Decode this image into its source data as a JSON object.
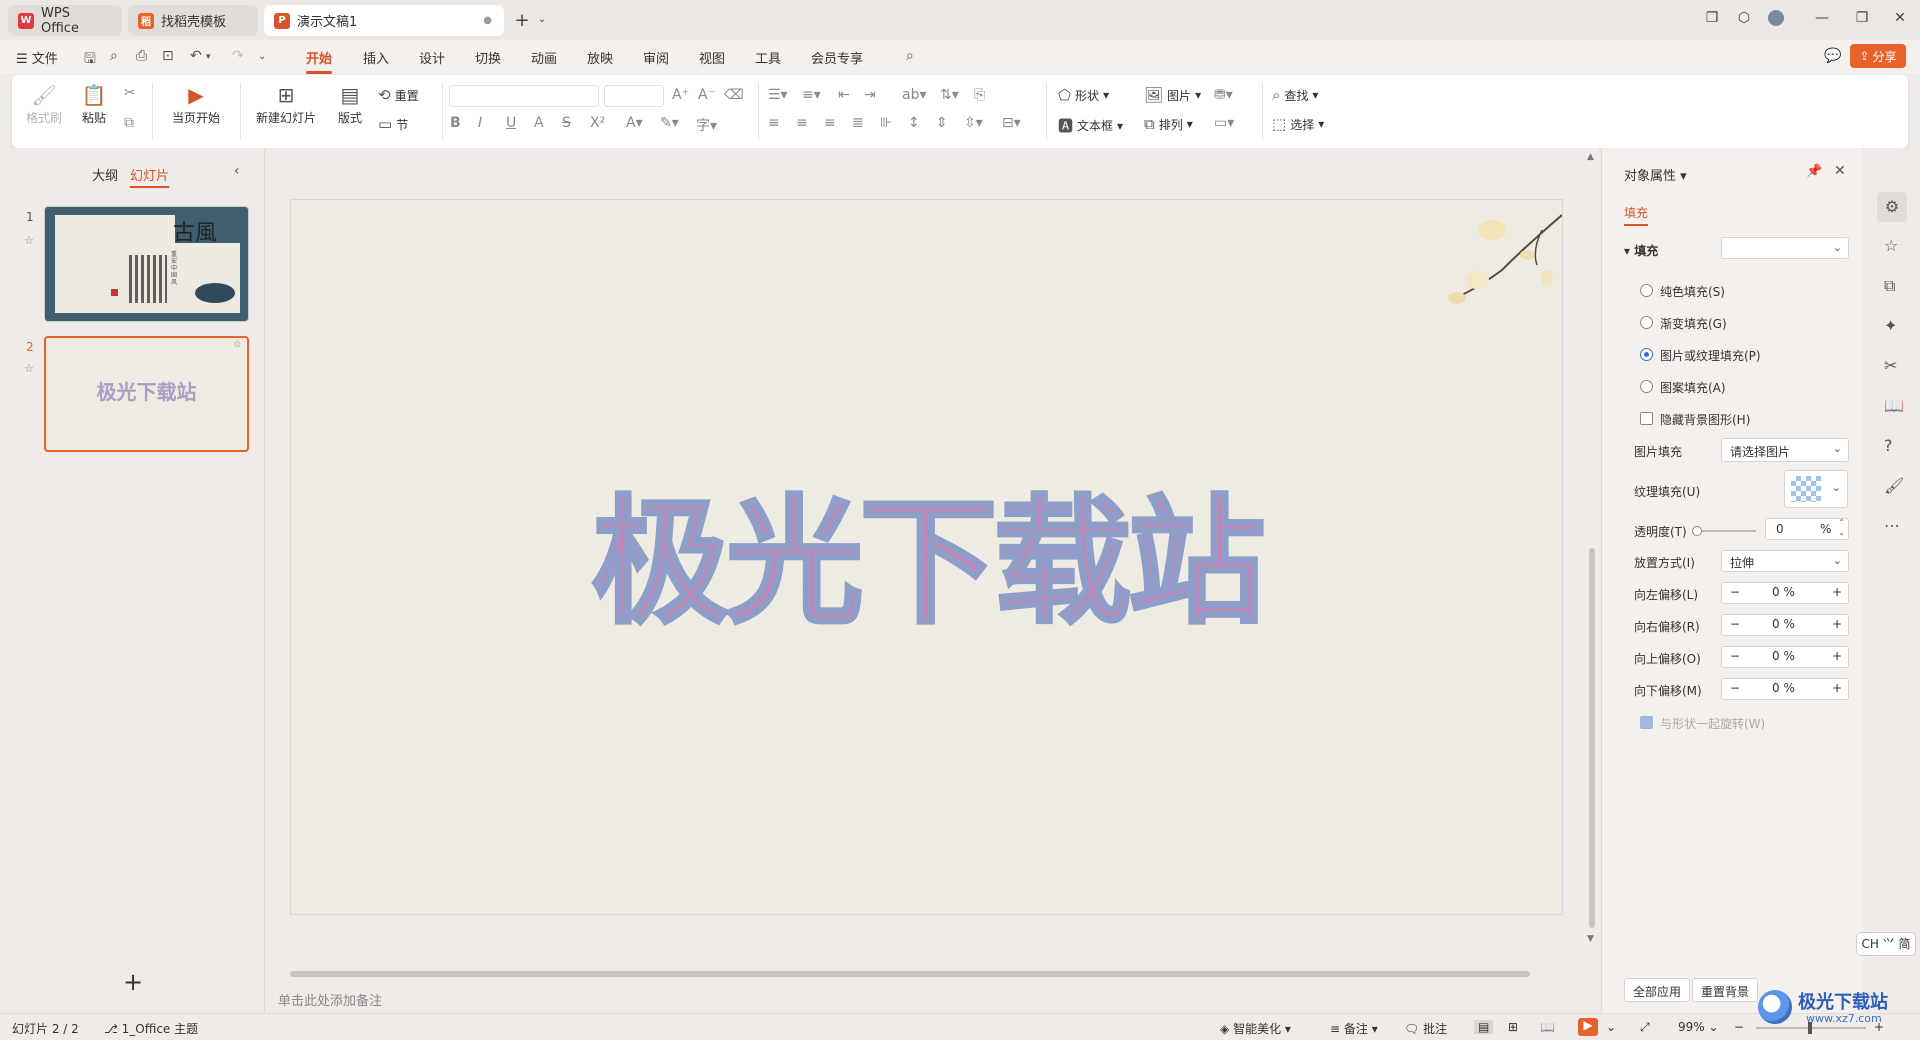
{
  "tabs": {
    "wps_label": "WPS Office",
    "template_label": "找稻壳模板",
    "doc_label": "演示文稿1"
  },
  "menu": {
    "file": "文件",
    "items": [
      "开始",
      "插入",
      "设计",
      "切换",
      "动画",
      "放映",
      "审阅",
      "视图",
      "工具",
      "会员专享"
    ],
    "share": "分享"
  },
  "ribbon": {
    "format_painter": "格式刷",
    "paste": "粘贴",
    "play_current": "当页开始",
    "new_slide": "新建幻灯片",
    "layout": "版式",
    "reset": "重置",
    "section": "节",
    "shape": "形状",
    "picture": "图片",
    "textbox": "文本框",
    "arrange": "排列",
    "find": "查找",
    "select": "选择"
  },
  "left_panel": {
    "tab_outline": "大纲",
    "tab_slides": "幻灯片",
    "slides": [
      {
        "num": "1",
        "title": "古風",
        "subtitle": "重安中国风"
      },
      {
        "num": "2",
        "title": "极光下载站"
      }
    ],
    "add_slide": "+"
  },
  "slide": {
    "title": "极光下载站"
  },
  "notes_placeholder": "单击此处添加备注",
  "props": {
    "title": "对象属性",
    "tab_fill": "填充",
    "section_fill": "填充",
    "opt_solid": "纯色填充(S)",
    "opt_gradient": "渐变填充(G)",
    "opt_picture": "图片或纹理填充(P)",
    "opt_pattern": "图案填充(A)",
    "hide_bg": "隐藏背景图形(H)",
    "picture_fill_label": "图片填充",
    "picture_fill_value": "请选择图片",
    "texture_label": "纹理填充(U)",
    "transparency_label": "透明度(T)",
    "transparency_value": "0",
    "percent": "%",
    "placement_label": "放置方式(I)",
    "placement_value": "拉伸",
    "offset_left_label": "向左偏移(L)",
    "offset_right_label": "向右偏移(R)",
    "offset_up_label": "向上偏移(O)",
    "offset_down_label": "向下偏移(M)",
    "offset_value": "0 %",
    "rotate_with_shape": "与形状一起旋转(W)",
    "apply_all": "全部应用",
    "reset_bg": "重置背景"
  },
  "ime": "CH ⺍ 简",
  "status": {
    "slide_count": "幻灯片 2 / 2",
    "theme": "1_Office 主题",
    "smart": "智能美化",
    "notes": "备注",
    "comments": "批注",
    "zoom": "99%"
  },
  "watermark": {
    "text": "极光下载站",
    "url": "www.xz7.com"
  },
  "colors": {
    "accent": "#d9532c",
    "title_fill": "#c583b3",
    "title_stroke": "#8f9ec8",
    "selected_border": "#e8632b"
  }
}
